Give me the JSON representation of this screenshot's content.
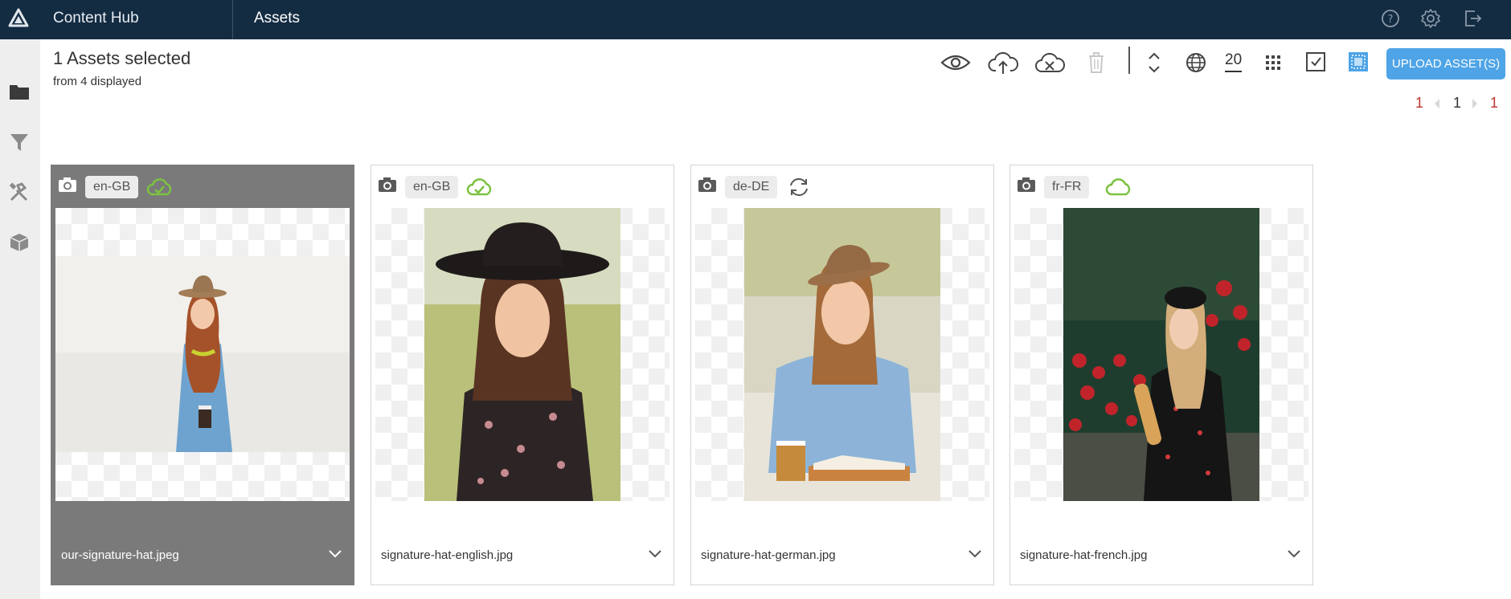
{
  "header": {
    "app_title": "Content Hub",
    "section_title": "Assets",
    "icons": [
      "logo-icon",
      "help-icon",
      "settings-icon",
      "logout-icon"
    ]
  },
  "sidebar": {
    "items": [
      "folder-icon",
      "filter-icon",
      "tools-icon",
      "package-icon"
    ]
  },
  "selection": {
    "title": "1 Assets selected",
    "subtitle": "from 4 displayed"
  },
  "toolbar": {
    "page_size": "20",
    "upload_label": "UPLOAD ASSET(S)",
    "icons": [
      "preview-icon",
      "cloud-upload-icon",
      "cloud-cancel-icon",
      "trash-icon",
      "sort-icon",
      "globe-icon",
      "grid-icon",
      "select-all-icon",
      "select-region-icon"
    ]
  },
  "pagination": {
    "first": "1",
    "current": "1",
    "last": "1"
  },
  "colors": {
    "topbar": "#142c42",
    "accent": "#4ea4e6",
    "synced_green": "#7dc242",
    "pager_red": "#c0342f",
    "selected_card": "#7a7a7a"
  },
  "assets": [
    {
      "locale": "en-GB",
      "status": "synced-cloud-icon",
      "filename": "our-signature-hat.jpeg",
      "selected": true
    },
    {
      "locale": "en-GB",
      "status": "synced-cloud-icon",
      "filename": "signature-hat-english.jpg",
      "selected": false
    },
    {
      "locale": "de-DE",
      "status": "syncing-icon",
      "filename": "signature-hat-german.jpg",
      "selected": false
    },
    {
      "locale": "fr-FR",
      "status": "cloud-outline-icon",
      "filename": "signature-hat-french.jpg",
      "selected": false
    }
  ]
}
